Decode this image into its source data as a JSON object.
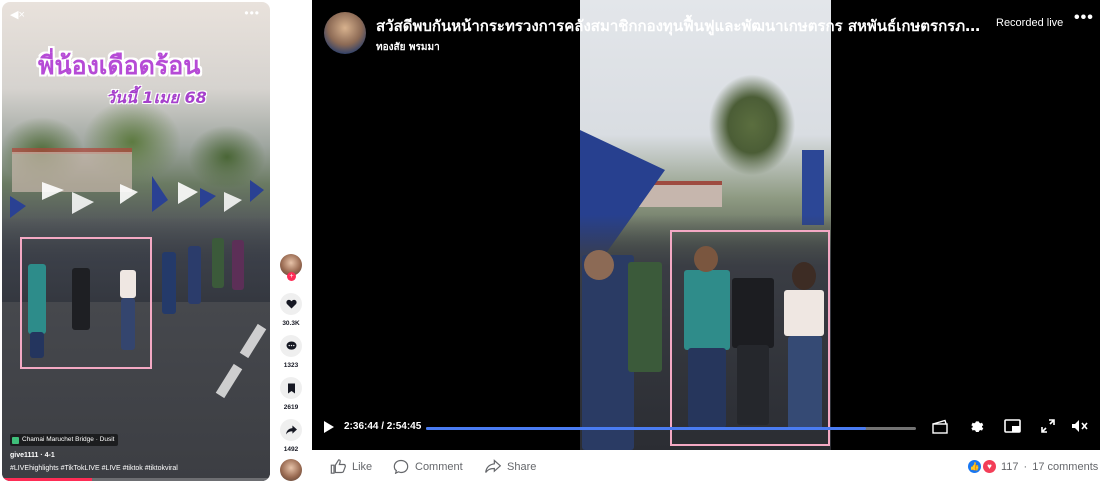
{
  "tiktok": {
    "title": "พี่น้องเดือดร้อน",
    "subtitle": "วันนี้ 1เมย 68",
    "mute_icon": "◀×",
    "more_icon": "•••",
    "location": "Chamai Maruchet Bridge · Dusit",
    "username": "give1111 · 4-1",
    "hashtags": "#LIVEhighlights #TikTokLIVE #LIVE #tiktok #tiktokviral",
    "accent_color": "#fe2c55"
  },
  "rail": {
    "likes": "30.3K",
    "comments": "1323",
    "saves": "2619",
    "shares": "1492"
  },
  "facebook": {
    "video_title": "สวัสดีพบกันหน้ากระทรวงการคลังสมาชิกกองทุนฟื้นฟูและพัฒนาเกษตรกร สหพันธ์เกษตรกรภาคเหนือ",
    "owner": "ทองสัย พรมมา",
    "recorded_label": "Recorded live",
    "more_icon": "•••",
    "time_display": "2:36:44 / 2:54:45",
    "progress": 0.897,
    "progress_color": "#4a7cf2",
    "actions": {
      "like": "Like",
      "comment": "Comment",
      "share": "Share"
    },
    "reaction_count": "117",
    "comments_count": "17 comments",
    "separator": "·"
  }
}
